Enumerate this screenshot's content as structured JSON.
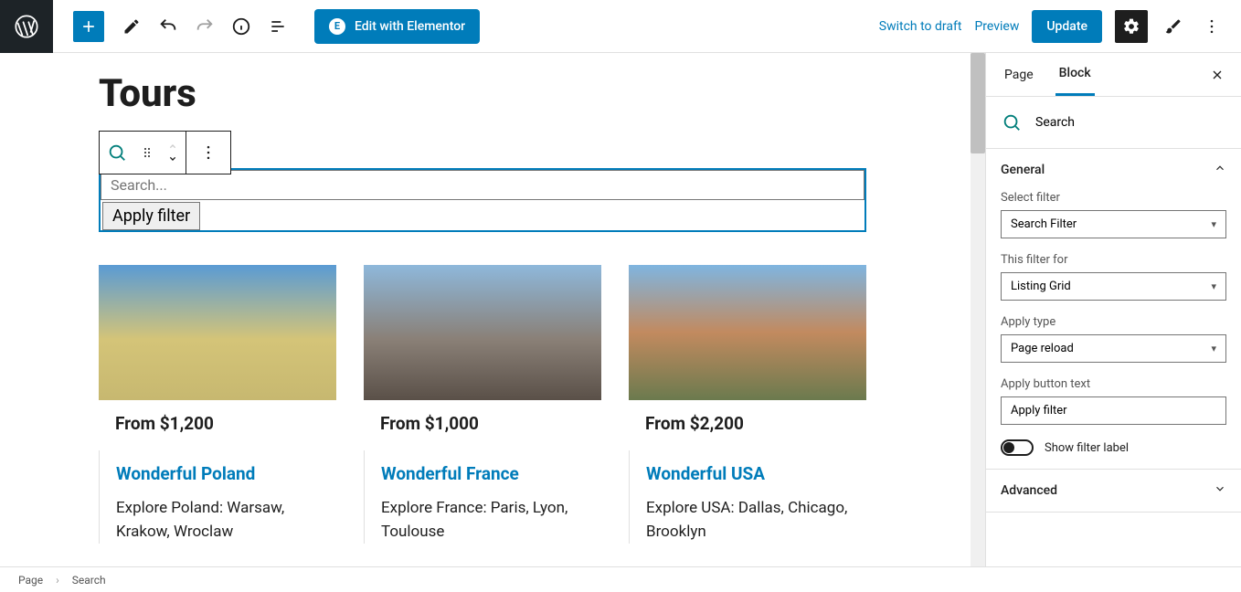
{
  "topbar": {
    "elementor_label": "Edit with Elementor",
    "switch_draft": "Switch to draft",
    "preview": "Preview",
    "update": "Update"
  },
  "canvas": {
    "page_title": "Tours",
    "search_placeholder": "Search...",
    "apply_filter": "Apply filter",
    "cards": [
      {
        "price": "From $1,200",
        "title": "Wonderful Poland",
        "desc": "Explore Poland: Warsaw, Krakow, Wroclaw"
      },
      {
        "price": "From $1,000",
        "title": "Wonderful France",
        "desc": "Explore France: Paris, Lyon, Toulouse"
      },
      {
        "price": "From $2,200",
        "title": "Wonderful USA",
        "desc": "Explore USA: Dallas, Chicago, Brooklyn"
      }
    ]
  },
  "sidebar": {
    "tab_page": "Page",
    "tab_block": "Block",
    "block_name": "Search",
    "sections": {
      "general": {
        "title": "General",
        "select_filter_label": "Select filter",
        "select_filter_value": "Search Filter",
        "this_filter_for_label": "This filter for",
        "this_filter_for_value": "Listing Grid",
        "apply_type_label": "Apply type",
        "apply_type_value": "Page reload",
        "apply_button_text_label": "Apply button text",
        "apply_button_text_value": "Apply filter",
        "show_filter_label": "Show filter label"
      },
      "advanced": {
        "title": "Advanced"
      }
    }
  },
  "footer": {
    "crumb1": "Page",
    "crumb2": "Search"
  }
}
